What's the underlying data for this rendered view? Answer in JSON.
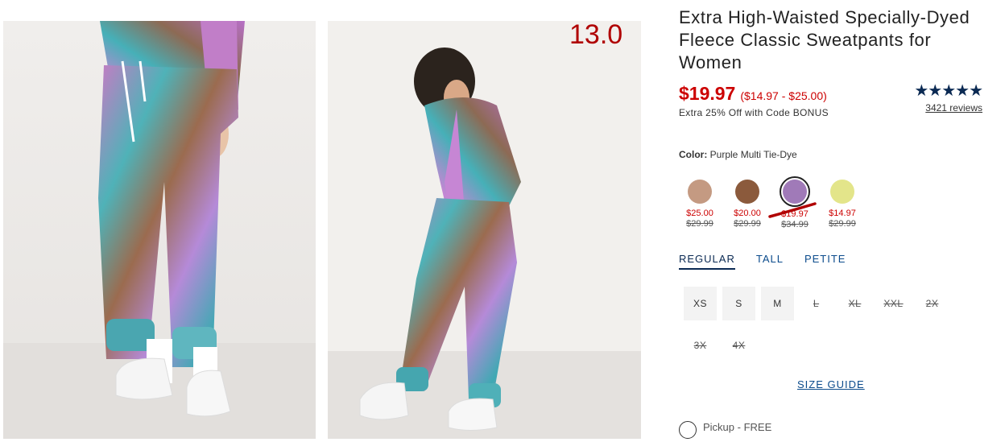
{
  "overlay": {
    "step_counter": "13.0"
  },
  "product": {
    "title": "Extra High-Waisted Specially-Dyed Fleece Classic Sweatpants for Women",
    "price": "$19.97",
    "price_range": "($14.97 - $25.00)",
    "promo": "Extra 25% Off with Code BONUS",
    "rating": {
      "stars": "★★★★★",
      "value": 5,
      "reviews": "3421 reviews"
    }
  },
  "color": {
    "label": "Color:",
    "selected": "Purple Multi Tie-Dye",
    "swatches": [
      {
        "color": "#c49a82",
        "sale": "$25.00",
        "original": "$29.99"
      },
      {
        "color": "#8b5a3c",
        "sale": "$20.00",
        "original": "$29.99"
      },
      {
        "color": "#a07ab8",
        "sale": "$19.97",
        "original": "$34.99",
        "selected": true
      },
      {
        "color": "#e3e58a",
        "sale": "$14.97",
        "original": "$29.99"
      }
    ]
  },
  "fit_tabs": [
    "REGULAR",
    "TALL",
    "PETITE"
  ],
  "sizes": [
    {
      "label": "XS",
      "available": true
    },
    {
      "label": "S",
      "available": true
    },
    {
      "label": "M",
      "available": true
    },
    {
      "label": "L",
      "available": false
    },
    {
      "label": "XL",
      "available": false
    },
    {
      "label": "XXL",
      "available": false
    },
    {
      "label": "2X",
      "available": false
    },
    {
      "label": "3X",
      "available": false
    },
    {
      "label": "4X",
      "available": false
    }
  ],
  "size_guide": "SIZE GUIDE",
  "pickup": {
    "label": "Pickup - FREE"
  },
  "colors": {
    "sale_red": "#cc0000",
    "navy": "#0b2a53",
    "link_blue": "#0b4b8c"
  },
  "images": [
    {
      "name": "product-image-front",
      "description_icon": "photo-icon"
    },
    {
      "name": "product-image-side",
      "description_icon": "photo-icon"
    }
  ]
}
